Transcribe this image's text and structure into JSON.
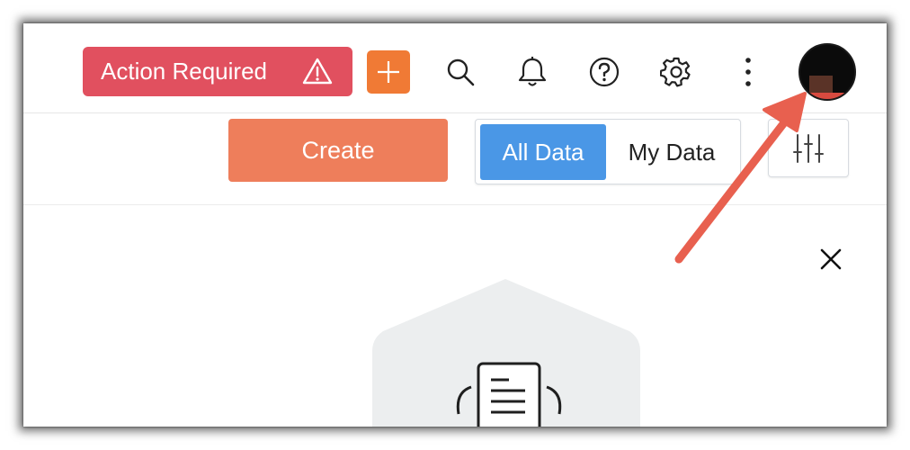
{
  "header": {
    "action_required_label": "Action Required",
    "icons": [
      "warning-icon",
      "plus-icon",
      "search-icon",
      "bell-icon",
      "help-icon",
      "gear-icon",
      "more-vertical-icon",
      "avatar"
    ]
  },
  "toolbar": {
    "create_label": "Create",
    "all_data_label": "All Data",
    "my_data_label": "My Data",
    "selected_segment": "All Data"
  },
  "colors": {
    "action_required": "#e1505f",
    "plus_button": "#f07a35",
    "create_button": "#ee7e5b",
    "segment_active": "#4a97e6",
    "annotation_arrow": "#e8604f"
  }
}
